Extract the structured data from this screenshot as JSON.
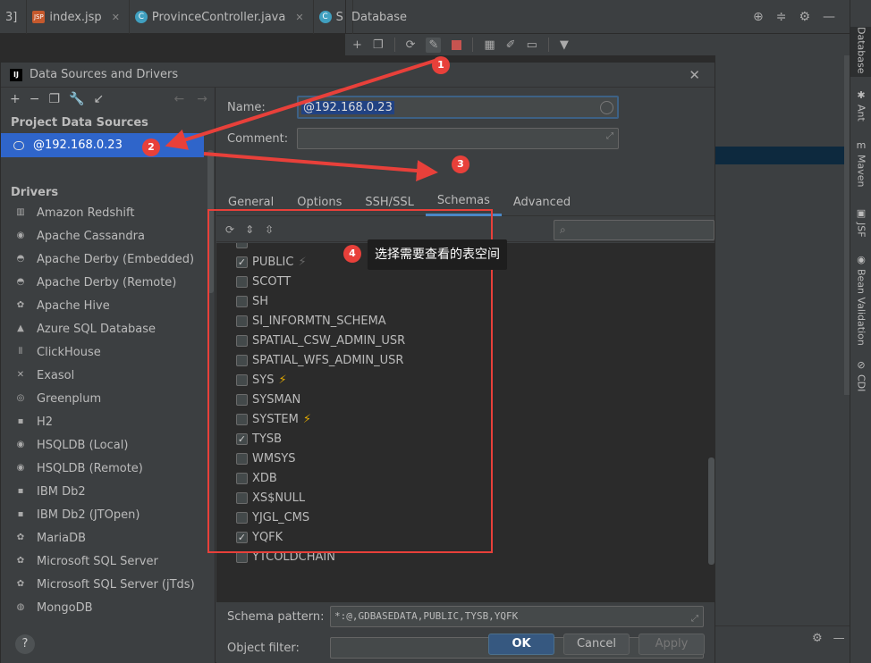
{
  "ide": {
    "tabs": [
      {
        "label": "3]",
        "icon": "none"
      },
      {
        "label": "index.jsp",
        "icon": "jsp-file-icon"
      },
      {
        "label": "ProvinceController.java",
        "icon": "java-class-icon"
      },
      {
        "label": "S",
        "icon": "java-class-icon"
      }
    ],
    "database_panel_title": "Database",
    "right_strip": [
      "Database",
      "Ant",
      "Maven",
      "JSF",
      "Bean Validation",
      "CDI"
    ]
  },
  "dialog": {
    "title": "Data Sources and Drivers",
    "close_glyph": "✕",
    "left": {
      "section_project": "Project Data Sources",
      "selected_source": "@192.168.0.23",
      "section_drivers": "Drivers",
      "drivers": [
        "Amazon Redshift",
        "Apache Cassandra",
        "Apache Derby (Embedded)",
        "Apache Derby (Remote)",
        "Apache Hive",
        "Azure SQL Database",
        "ClickHouse",
        "Exasol",
        "Greenplum",
        "H2",
        "HSQLDB (Local)",
        "HSQLDB (Remote)",
        "IBM Db2",
        "IBM Db2 (JTOpen)",
        "MariaDB",
        "Microsoft SQL Server",
        "Microsoft SQL Server (jTds)",
        "MongoDB"
      ],
      "help": "?"
    },
    "right": {
      "name_label": "Name:",
      "name_value": "@192.168.0.23",
      "comment_label": "Comment:",
      "comment_value": "",
      "tabs": [
        "General",
        "Options",
        "SSH/SSL",
        "Schemas",
        "Advanced"
      ],
      "active_tab": "Schemas",
      "search_placeholder": "",
      "schemas": [
        {
          "name": "PUBLIC",
          "checked": true,
          "bolt": "dim"
        },
        {
          "name": "SCOTT",
          "checked": false,
          "bolt": ""
        },
        {
          "name": "SH",
          "checked": false,
          "bolt": ""
        },
        {
          "name": "SI_INFORMTN_SCHEMA",
          "checked": false,
          "bolt": ""
        },
        {
          "name": "SPATIAL_CSW_ADMIN_USR",
          "checked": false,
          "bolt": ""
        },
        {
          "name": "SPATIAL_WFS_ADMIN_USR",
          "checked": false,
          "bolt": ""
        },
        {
          "name": "SYS",
          "checked": false,
          "bolt": "yellow"
        },
        {
          "name": "SYSMAN",
          "checked": false,
          "bolt": ""
        },
        {
          "name": "SYSTEM",
          "checked": false,
          "bolt": "yellow"
        },
        {
          "name": "TYSB",
          "checked": true,
          "bolt": ""
        },
        {
          "name": "WMSYS",
          "checked": false,
          "bolt": ""
        },
        {
          "name": "XDB",
          "checked": false,
          "bolt": ""
        },
        {
          "name": "XS$NULL",
          "checked": false,
          "bolt": ""
        },
        {
          "name": "YJGL_CMS",
          "checked": false,
          "bolt": ""
        },
        {
          "name": "YQFK",
          "checked": true,
          "bolt": ""
        },
        {
          "name": "YTCOLDCHAIN",
          "checked": false,
          "bolt": ""
        }
      ],
      "schema_pattern_label": "Schema pattern:",
      "schema_pattern_value": "*:@,GDBASEDATA,PUBLIC,TYSB,YQFK",
      "object_filter_label": "Object filter:",
      "object_filter_value": ""
    },
    "buttons": {
      "ok": "OK",
      "cancel": "Cancel",
      "apply": "Apply"
    }
  },
  "annotations": {
    "badges": [
      "1",
      "2",
      "3",
      "4"
    ],
    "tooltip": "选择需要查看的表空间",
    "color": "#e8403a"
  },
  "colors": {
    "selection": "#2f65ca",
    "accent_tab": "#4a88c7",
    "ok_button": "#365880",
    "annotation_red": "#e8403a",
    "bolt_yellow": "#e0a800"
  }
}
